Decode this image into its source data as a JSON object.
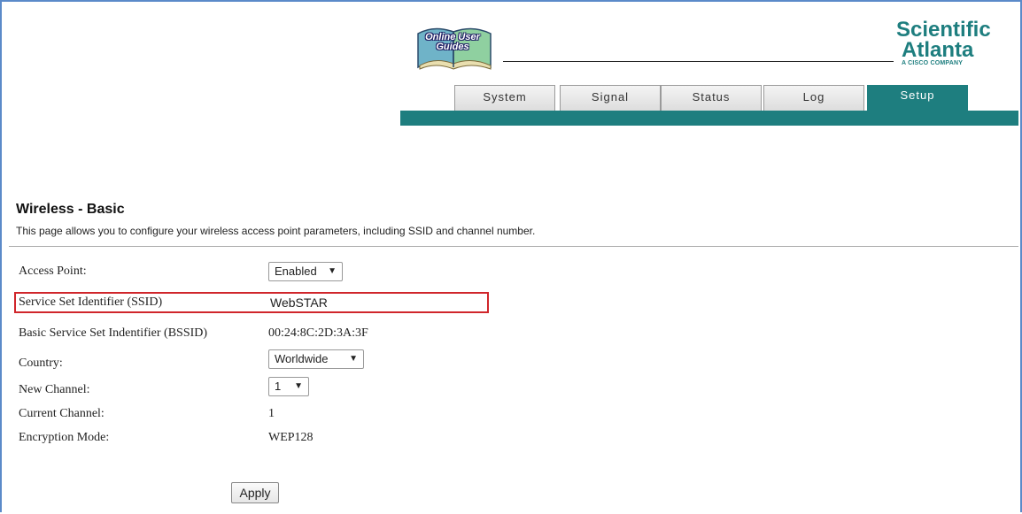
{
  "header": {
    "guide_logo_text": "Online User Guides",
    "brand": {
      "line1": "Scientific",
      "line2": "Atlanta",
      "line3": "A CISCO COMPANY"
    },
    "tabs": [
      {
        "label": "System",
        "active": false
      },
      {
        "label": "Signal",
        "active": false
      },
      {
        "label": "Status",
        "active": false
      },
      {
        "label": "Log",
        "active": false
      },
      {
        "label": "Setup",
        "active": true
      }
    ],
    "accent_color": "#1e7e7f"
  },
  "page": {
    "title": "Wireless - Basic",
    "description": "This page allows you to configure your wireless access point parameters, including SSID and channel number."
  },
  "fields": {
    "access_point": {
      "label": "Access Point:",
      "value": "Enabled",
      "options": [
        "Enabled"
      ]
    },
    "ssid": {
      "label": "Service Set Identifier (SSID)",
      "value": "WebSTAR",
      "highlight_color": "#d0262b"
    },
    "bssid": {
      "label": "Basic Service Set Indentifier (BSSID)",
      "value": "00:24:8C:2D:3A:3F"
    },
    "country": {
      "label": "Country:",
      "value": "Worldwide"
    },
    "new_channel": {
      "label": "New Channel:",
      "value": "1"
    },
    "current_channel": {
      "label": "Current Channel:",
      "value": "1"
    },
    "encryption_mode": {
      "label": "Encryption Mode:",
      "value": "WEP128"
    }
  },
  "actions": {
    "apply_label": "Apply"
  },
  "icons": {
    "dropdown": "caret-down-icon",
    "guide": "book-icon"
  }
}
